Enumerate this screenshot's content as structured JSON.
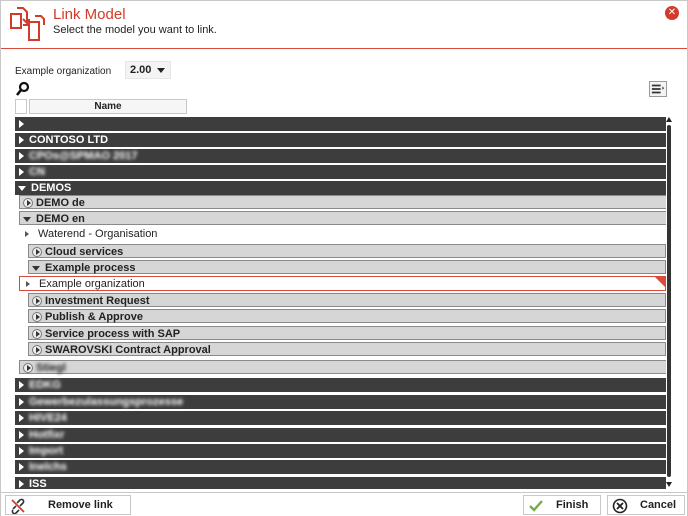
{
  "header": {
    "title": "Link Model",
    "subtitle": "Select the model you want to link.",
    "close_icon": "close-icon",
    "accent": "#d23a2a"
  },
  "filter": {
    "organization_label": "Example organization",
    "version": "2.00"
  },
  "columns": {
    "name": "Name"
  },
  "tree": {
    "rows": [
      {
        "label": "",
        "blurred": false
      },
      {
        "label": "CONTOSO LTD",
        "blurred": false
      },
      {
        "label": "CPOs@SPMAO 2017",
        "blurred": true
      },
      {
        "label": "CN",
        "blurred": true
      },
      {
        "label": "DEMOS",
        "blurred": false
      },
      {
        "label": "DEMO de",
        "blurred": false
      },
      {
        "label": "DEMO en",
        "blurred": false
      },
      {
        "label": "Waterend - Organisation",
        "blurred": false
      },
      {
        "label": "Cloud services",
        "blurred": false
      },
      {
        "label": "Example process",
        "blurred": false
      },
      {
        "label": "Example organization",
        "blurred": false
      },
      {
        "label": "Investment Request",
        "blurred": false
      },
      {
        "label": "Publish & Approve",
        "blurred": false
      },
      {
        "label": "Service process with SAP",
        "blurred": false
      },
      {
        "label": "SWAROVSKI Contract Approval",
        "blurred": false
      },
      {
        "label": "Stiegl",
        "blurred": true
      },
      {
        "label": "EDKG",
        "blurred": true
      },
      {
        "label": "Gewerbezulassungsprozesse",
        "blurred": true
      },
      {
        "label": "HIVE24",
        "blurred": true
      },
      {
        "label": "Hotfixr",
        "blurred": true
      },
      {
        "label": "Import",
        "blurred": true
      },
      {
        "label": "Inelchs",
        "blurred": true
      },
      {
        "label": "ISS",
        "blurred": true
      }
    ]
  },
  "footer": {
    "remove_link": "Remove link",
    "finish": "Finish",
    "cancel": "Cancel"
  }
}
